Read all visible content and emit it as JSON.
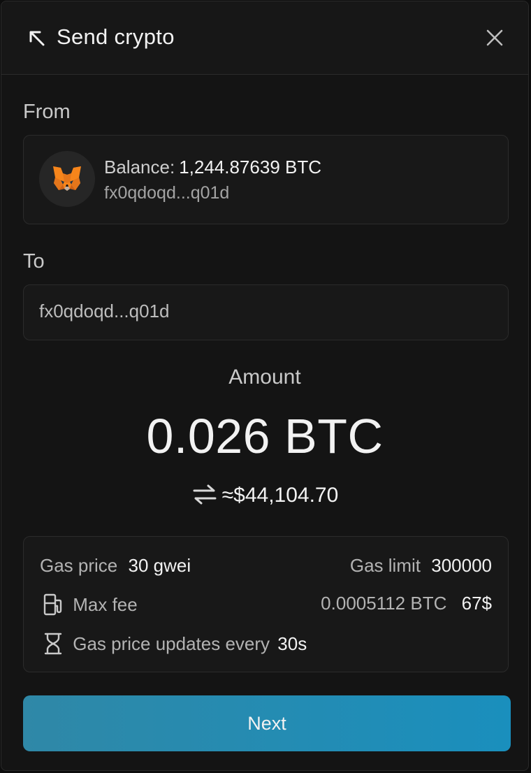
{
  "header": {
    "title": "Send crypto"
  },
  "from": {
    "label": "From",
    "balance_label": "Balance:",
    "balance_value": "1,244.87639 BTC",
    "address": "fx0qdoqd...q01d"
  },
  "to": {
    "label": "To",
    "address_value": "fx0qdoqd...q01d"
  },
  "amount": {
    "label": "Amount",
    "value": "0.026 BTC",
    "fiat": "≈$44,104.70"
  },
  "gas": {
    "price_label": "Gas price",
    "price_value": "30 gwei",
    "limit_label": "Gas limit",
    "limit_value": "300000",
    "max_fee_label": "Max fee",
    "max_fee_crypto": "0.0005112 BTC",
    "max_fee_fiat": "67$",
    "update_label": "Gas price updates every",
    "update_value": "30s"
  },
  "actions": {
    "next_label": "Next"
  },
  "colors": {
    "accent": "#1a8fbd",
    "background": "#141414",
    "card": "#181818"
  },
  "icons": [
    "back-arrow-icon",
    "close-icon",
    "metamask-fox-icon",
    "swap-arrows-icon",
    "fuel-pump-icon",
    "hourglass-icon"
  ]
}
